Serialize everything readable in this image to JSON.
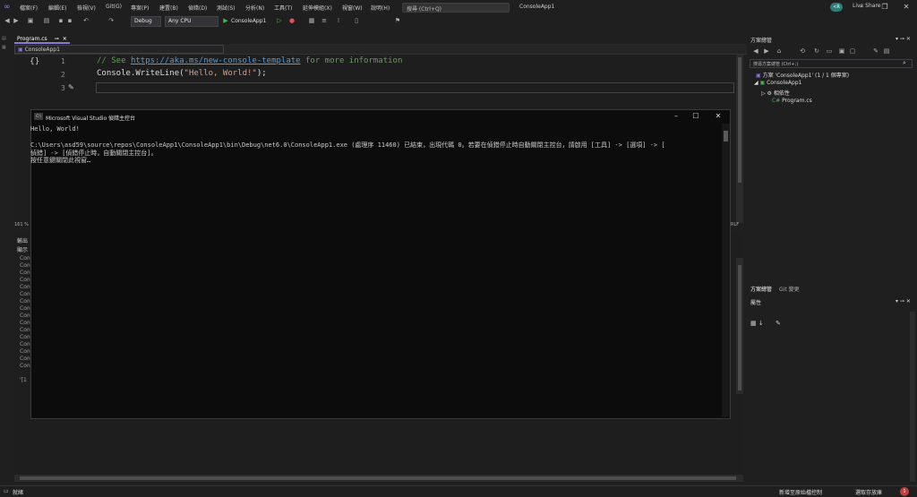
{
  "menu": {
    "items": [
      "檔案(F)",
      "編輯(E)",
      "檢視(V)",
      "Git(G)",
      "專案(P)",
      "建置(B)",
      "偵錯(D)",
      "測試(S)",
      "分析(N)",
      "工具(T)",
      "延伸模組(X)",
      "視窗(W)",
      "說明(H)"
    ],
    "search_placeholder": "搜尋 (Ctrl+Q)",
    "window_title": "ConsoleApp1",
    "avatar_initials": "<R"
  },
  "toolbar": {
    "config": "Debug",
    "platform": "Any CPU",
    "run_label": "ConsoleApp1",
    "live_share": "Live Share"
  },
  "editor": {
    "tab_label": "Program.cs",
    "nav_project": "ConsoleApp1",
    "line_numbers": [
      "1",
      "2",
      "3"
    ],
    "code": {
      "comment_prefix": "// See ",
      "comment_link": "https://aka.ms/new-console-template",
      "comment_suffix": " for more information",
      "line2_call": "Console.WriteLine(",
      "line2_string": "\"Hello, World!\"",
      "line2_end": ");"
    },
    "zoom": "161 %",
    "line_ending": "RLF"
  },
  "output": {
    "title": "輸出",
    "show_label": "顯示",
    "lines": [
      "Con",
      "Con",
      "Con",
      "Con",
      "Con",
      "Con",
      "Con",
      "Con",
      "Con",
      "Con",
      "Con",
      "Con",
      "Con",
      "Con",
      "Con",
      "Con",
      "'[1"
    ]
  },
  "console": {
    "title": "Microsoft Visual Studio 偵錯主控台",
    "lines": [
      "Hello, World!",
      "",
      "C:\\Users\\asd59\\source\\repos\\ConsoleApp1\\ConsoleApp1\\bin\\Debug\\net6.0\\ConsoleApp1.exe (處理序 11460) 已結束，出現代碼 0。若要在偵錯停止時自動關閉主控台，請啟用 [工具] -> [選項] -> [",
      "偵錯] -> [偵錯停止時，自動關閉主控台]。",
      "按任意鍵關閉此視窗…"
    ]
  },
  "solution_explorer": {
    "header": "方案總管",
    "search_placeholder": "搜尋方案總管 (Ctrl+;)",
    "solution": "方案 'ConsoleApp1' (1 / 1 個專案)",
    "project": "ConsoleApp1",
    "dependencies": "相依性",
    "file": "Program.cs",
    "tabs": [
      "方案總管",
      "Git 變更"
    ]
  },
  "properties": {
    "header": "屬性"
  },
  "status": {
    "ready": "就緒",
    "add_source_control": "新增至原始檔控制",
    "select_repo": "選取存放庫",
    "notifications": "1"
  },
  "colors": {
    "accent": "#8c77d6",
    "comment": "#57a64a",
    "link": "#569cd6",
    "string": "#d69d85",
    "type": "#4ec9b0"
  }
}
